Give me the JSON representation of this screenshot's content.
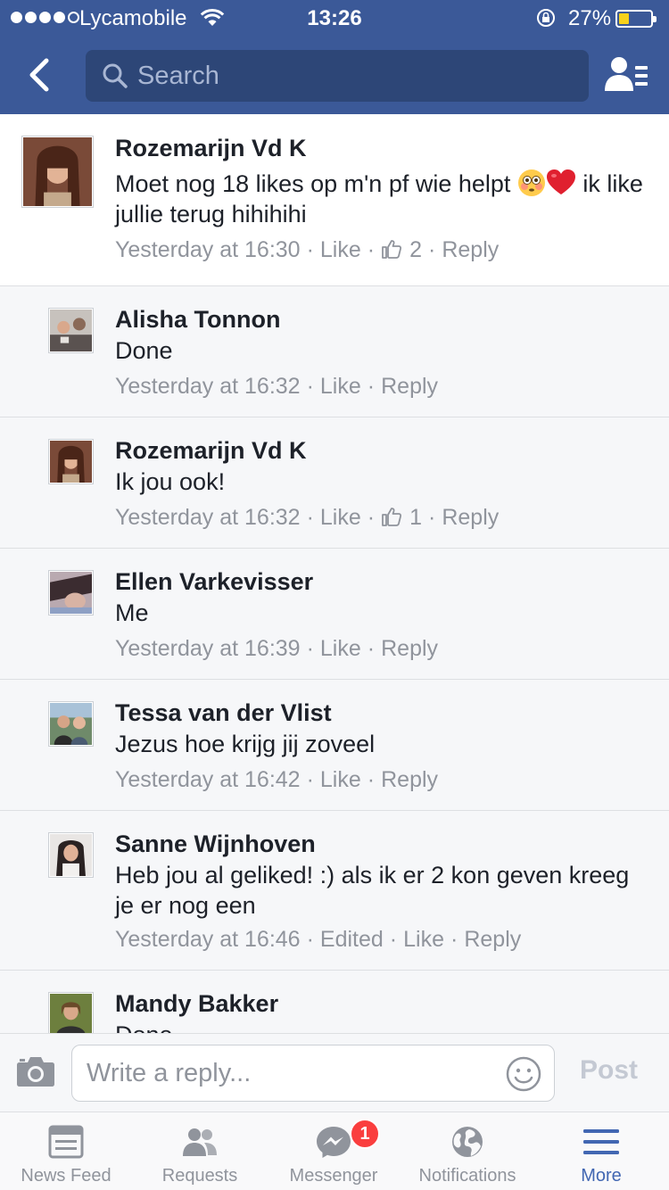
{
  "status_bar": {
    "carrier": "Lycamobile",
    "time": "13:26",
    "battery_percent": "27%",
    "battery_level": 0.27,
    "signal_bars_filled": 4,
    "signal_bars_total": 5
  },
  "header": {
    "search_placeholder": "Search",
    "accent_color": "#3b5998"
  },
  "comments": [
    {
      "author": "Rozemarijn Vd K",
      "text": "Moet nog 18 likes op m'n pf wie helpt 😳❤️ ik like jullie terug hihihihi",
      "time": "Yesterday at 16:30",
      "like_label": "Like",
      "like_count": "2",
      "reply_label": "Reply",
      "is_top_level": true
    },
    {
      "author": "Alisha Tonnon",
      "text": "Done",
      "time": "Yesterday at 16:32",
      "like_label": "Like",
      "reply_label": "Reply"
    },
    {
      "author": "Rozemarijn Vd K",
      "text": "Ik jou ook!",
      "time": "Yesterday at 16:32",
      "like_label": "Like",
      "like_count": "1",
      "reply_label": "Reply"
    },
    {
      "author": "Ellen Varkevisser",
      "text": "Me",
      "time": "Yesterday at 16:39",
      "like_label": "Like",
      "reply_label": "Reply"
    },
    {
      "author": "Tessa van der Vlist",
      "text": "Jezus hoe krijg jij zoveel",
      "time": "Yesterday at 16:42",
      "like_label": "Like",
      "reply_label": "Reply"
    },
    {
      "author": "Sanne Wijnhoven",
      "text": "Heb jou al geliked! :) als ik er 2 kon geven kreeg je er nog een",
      "time": "Yesterday at 16:46",
      "edited_label": "Edited",
      "like_label": "Like",
      "reply_label": "Reply"
    },
    {
      "author": "Mandy Bakker",
      "text": "Done"
    }
  ],
  "reply_bar": {
    "placeholder": "Write a reply...",
    "post_label": "Post"
  },
  "tab_bar": {
    "tabs": [
      {
        "label": "News Feed",
        "icon": "news-feed-icon"
      },
      {
        "label": "Requests",
        "icon": "friend-requests-icon"
      },
      {
        "label": "Messenger",
        "icon": "messenger-icon",
        "badge": "1"
      },
      {
        "label": "Notifications",
        "icon": "globe-icon"
      },
      {
        "label": "More",
        "icon": "hamburger-menu-icon",
        "active": true
      }
    ]
  }
}
